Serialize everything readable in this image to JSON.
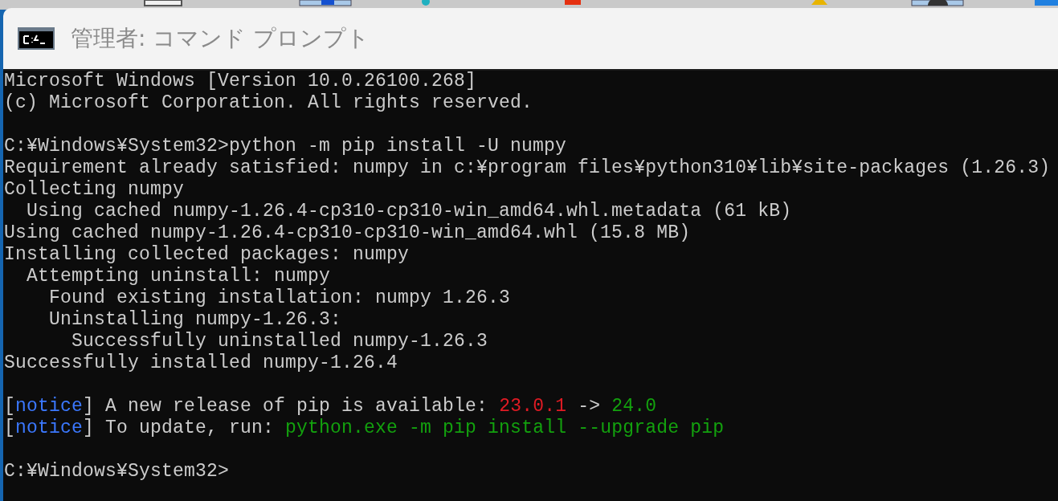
{
  "window": {
    "title": "管理者: コマンド プロンプト"
  },
  "console": {
    "lines": [
      {
        "kind": "text",
        "segments": [
          {
            "kind": "plain",
            "text": "Microsoft Windows [Version 10.0.26100.268]"
          }
        ]
      },
      {
        "kind": "text",
        "segments": [
          {
            "kind": "plain",
            "text": "(c) Microsoft Corporation. All rights reserved."
          }
        ]
      },
      {
        "kind": "blank"
      },
      {
        "kind": "text",
        "segments": [
          {
            "kind": "plain",
            "text": "C:¥Windows¥System32>python -m pip install -U numpy"
          }
        ]
      },
      {
        "kind": "text",
        "segments": [
          {
            "kind": "plain",
            "text": "Requirement already satisfied: numpy in c:¥program files¥python310¥lib¥site-packages (1.26.3)"
          }
        ]
      },
      {
        "kind": "text",
        "segments": [
          {
            "kind": "plain",
            "text": "Collecting numpy"
          }
        ]
      },
      {
        "kind": "text",
        "segments": [
          {
            "kind": "plain",
            "text": "  Using cached numpy-1.26.4-cp310-cp310-win_amd64.whl.metadata (61 kB)"
          }
        ]
      },
      {
        "kind": "text",
        "segments": [
          {
            "kind": "plain",
            "text": "Using cached numpy-1.26.4-cp310-cp310-win_amd64.whl (15.8 MB)"
          }
        ]
      },
      {
        "kind": "text",
        "segments": [
          {
            "kind": "plain",
            "text": "Installing collected packages: numpy"
          }
        ]
      },
      {
        "kind": "text",
        "segments": [
          {
            "kind": "plain",
            "text": "  Attempting uninstall: numpy"
          }
        ]
      },
      {
        "kind": "text",
        "segments": [
          {
            "kind": "plain",
            "text": "    Found existing installation: numpy 1.26.3"
          }
        ]
      },
      {
        "kind": "text",
        "segments": [
          {
            "kind": "plain",
            "text": "    Uninstalling numpy-1.26.3:"
          }
        ]
      },
      {
        "kind": "text",
        "segments": [
          {
            "kind": "plain",
            "text": "      Successfully uninstalled numpy-1.26.3"
          }
        ]
      },
      {
        "kind": "text",
        "segments": [
          {
            "kind": "plain",
            "text": "Successfully installed numpy-1.26.4"
          }
        ]
      },
      {
        "kind": "blank"
      },
      {
        "kind": "text",
        "segments": [
          {
            "kind": "plain",
            "text": "["
          },
          {
            "kind": "notice",
            "text": "notice"
          },
          {
            "kind": "plain",
            "text": "] A new release of pip is available: "
          },
          {
            "kind": "old",
            "text": "23.0.1"
          },
          {
            "kind": "plain",
            "text": " -> "
          },
          {
            "kind": "new",
            "text": "24.0"
          }
        ]
      },
      {
        "kind": "text",
        "segments": [
          {
            "kind": "plain",
            "text": "["
          },
          {
            "kind": "notice",
            "text": "notice"
          },
          {
            "kind": "plain",
            "text": "] To update, run: "
          },
          {
            "kind": "new",
            "text": "python.exe -m pip install --upgrade pip"
          }
        ]
      },
      {
        "kind": "blank"
      },
      {
        "kind": "text",
        "segments": [
          {
            "kind": "plain",
            "text": "C:¥Windows¥System32>"
          }
        ]
      }
    ]
  }
}
